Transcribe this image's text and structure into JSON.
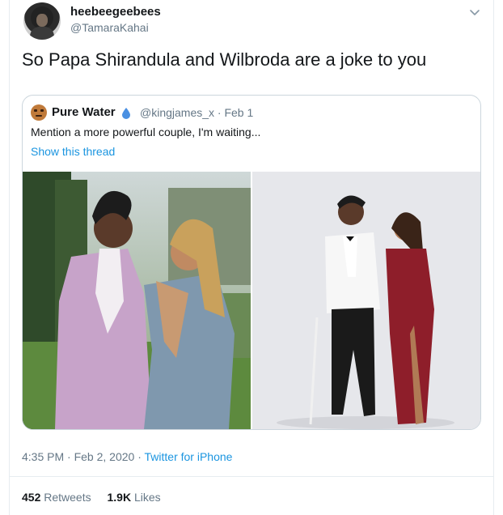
{
  "author": {
    "display_name": "heebeegeebees",
    "handle": "@TamaraKahai"
  },
  "tweet": {
    "text": "So Papa Shirandula and Wilbroda are a joke to you"
  },
  "quoted": {
    "display_name": "Pure Water",
    "handle_date": "@kingjames_x · Feb 1",
    "text": "Mention a more powerful couple, I'm waiting...",
    "show_thread": "Show this thread"
  },
  "meta": {
    "time_date": "4:35 PM · Feb 2, 2020 · ",
    "via": "Twitter for iPhone"
  },
  "stats": {
    "retweets_count": "452",
    "retweets_label": "Retweets",
    "likes_count": "1.9K",
    "likes_label": "Likes"
  },
  "colors": {
    "link": "#1b95e0",
    "secondary_text": "#657786",
    "border": "#ccd6dd"
  },
  "icons": {
    "menu": "chevron-down-icon",
    "verified_drop": "water-drop-icon"
  }
}
